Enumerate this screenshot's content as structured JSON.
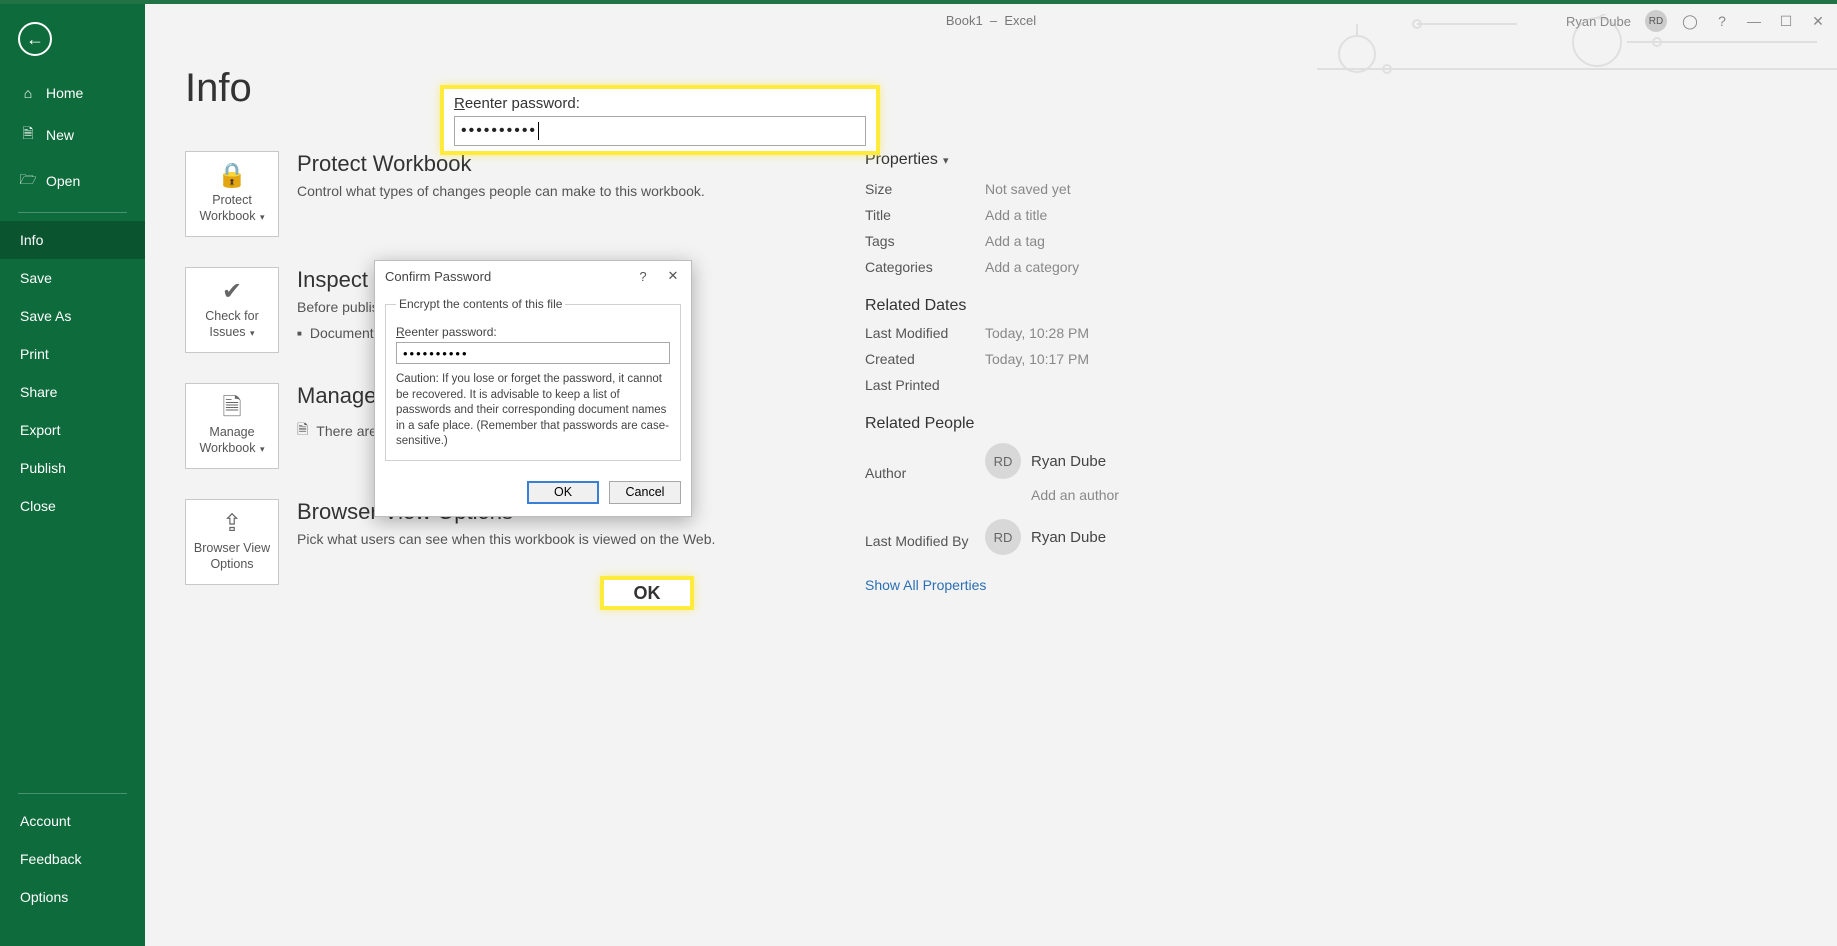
{
  "titlebar": {
    "doc_name": "Book1",
    "app_name": "Excel",
    "user_name": "Ryan Dube",
    "user_initials": "RD"
  },
  "sidebar": {
    "back": "←",
    "top_items": [
      {
        "icon": "⌂",
        "label": "Home"
      },
      {
        "icon": "🗎",
        "label": "New"
      },
      {
        "icon": "🗁",
        "label": "Open"
      }
    ],
    "mid_items": [
      {
        "label": "Info",
        "active": true
      },
      {
        "label": "Save"
      },
      {
        "label": "Save As"
      },
      {
        "label": "Print"
      },
      {
        "label": "Share"
      },
      {
        "label": "Export"
      },
      {
        "label": "Publish"
      },
      {
        "label": "Close"
      }
    ],
    "bottom_items": [
      {
        "label": "Account"
      },
      {
        "label": "Feedback"
      },
      {
        "label": "Options"
      }
    ]
  },
  "page": {
    "title": "Info",
    "sections": {
      "protect": {
        "tile_label": "Protect Workbook",
        "title": "Protect Workbook",
        "desc": "Control what types of changes people can make to this workbook."
      },
      "inspect": {
        "tile_label": "Check for Issues",
        "title": "Inspect Workbook",
        "desc": "Before publishing this file, be aware that it contains:",
        "bullet": "Document properties, author's name"
      },
      "manage": {
        "tile_label": "Manage Workbook",
        "title": "Manage Workbook",
        "desc": "There are no unsaved changes."
      },
      "browser": {
        "tile_label": "Browser View Options",
        "title": "Browser View Options",
        "desc": "Pick what users can see when this workbook is viewed on the Web."
      }
    },
    "properties": {
      "heading": "Properties",
      "rows": {
        "size_k": "Size",
        "size_v": "Not saved yet",
        "title_k": "Title",
        "title_v": "Add a title",
        "tags_k": "Tags",
        "tags_v": "Add a tag",
        "cats_k": "Categories",
        "cats_v": "Add a category"
      },
      "dates": {
        "heading": "Related Dates",
        "lastmod_k": "Last Modified",
        "lastmod_v": "Today, 10:28 PM",
        "created_k": "Created",
        "created_v": "Today, 10:17 PM",
        "lastprint_k": "Last Printed",
        "lastprint_v": ""
      },
      "people": {
        "heading": "Related People",
        "author_k": "Author",
        "author_name": "Ryan Dube",
        "author_initials": "RD",
        "add_author": "Add an author",
        "modby_k": "Last Modified By",
        "modby_name": "Ryan Dube",
        "modby_initials": "RD"
      },
      "show_all": "Show All Properties"
    }
  },
  "dialog": {
    "title": "Confirm Password",
    "group_legend": "Encrypt the contents of this file",
    "label": "Reenter password:",
    "value": "••••••••••",
    "caution": "Caution: If you lose or forget the password, it cannot be recovered. It is advisable to keep a list of passwords and their corresponding document names in a safe place. (Remember that passwords are case-sensitive.)",
    "ok": "OK",
    "cancel": "Cancel"
  },
  "callouts": {
    "reenter_label": "Reenter password:",
    "reenter_value": "••••••••••",
    "ok_label": "OK"
  }
}
